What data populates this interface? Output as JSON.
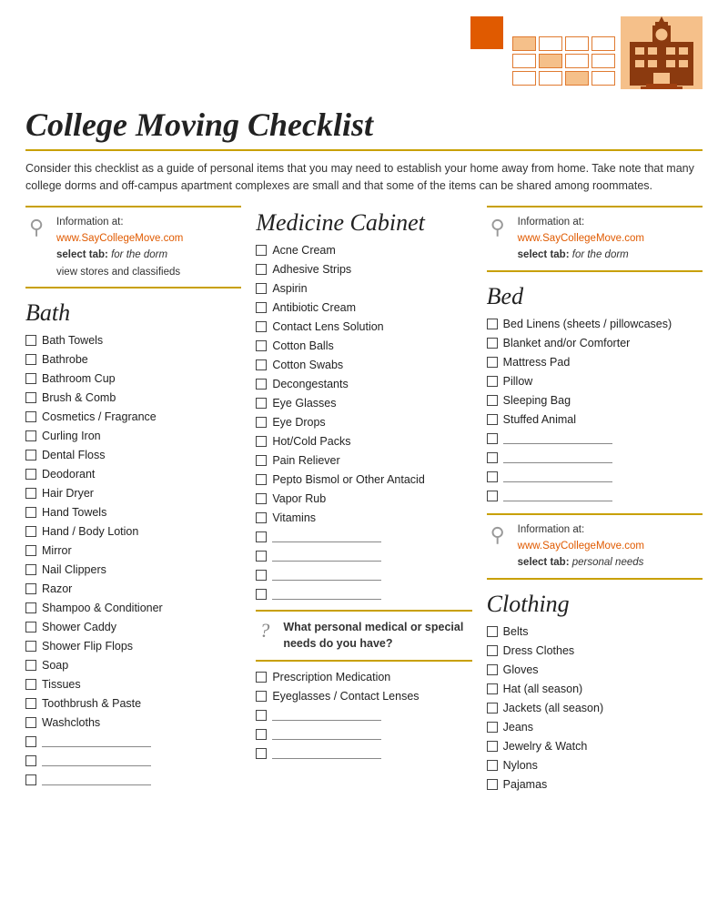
{
  "title": "College Moving Checklist",
  "intro": "Consider this checklist as a guide of personal items that you may need to establish your home away from home.  Take note that many college dorms and off-campus apartment complexes are small and that some of the items can be shared among roommates.",
  "info_box_1": {
    "label": "Information at:",
    "url": "www.SayCollegeMove.com",
    "select_label": "select tab:",
    "select_italic": "for the dorm",
    "extra": "view stores and classifieds"
  },
  "info_box_2": {
    "label": "Information at:",
    "url": "www.SayCollegeMove.com",
    "select_label": "select tab:",
    "select_italic": "for the dorm"
  },
  "info_box_3": {
    "label": "Information at:",
    "url": "www.SayCollegeMove.com",
    "select_label": "select tab:",
    "select_italic": "personal needs"
  },
  "bath": {
    "title": "Bath",
    "items": [
      "Bath Towels",
      "Bathrobe",
      "Bathroom Cup",
      "Brush & Comb",
      "Cosmetics / Fragrance",
      "Curling Iron",
      "Dental Floss",
      "Deodorant",
      "Hair Dryer",
      "Hand Towels",
      "Hand / Body Lotion",
      "Mirror",
      "Nail Clippers",
      "Razor",
      "Shampoo & Conditioner",
      "Shower Caddy",
      "Shower Flip Flops",
      "Soap",
      "Tissues",
      "Toothbrush & Paste",
      "Washcloths"
    ],
    "blanks": 3
  },
  "medicine": {
    "title": "Medicine Cabinet",
    "items": [
      "Acne Cream",
      "Adhesive Strips",
      "Aspirin",
      "Antibiotic Cream",
      "Contact Lens Solution",
      "Cotton Balls",
      "Cotton Swabs",
      "Decongestants",
      "Eye Glasses",
      "Eye Drops",
      "Hot/Cold Packs",
      "Pain Reliever",
      "Pepto Bismol or Other Antacid",
      "Vapor Rub",
      "Vitamins"
    ],
    "blanks": 4,
    "question": "What personal medical or special needs do you have?",
    "extra_items": [
      "Prescription Medication",
      "Eyeglasses / Contact Lenses"
    ],
    "extra_blanks": 3
  },
  "bed": {
    "title": "Bed",
    "items": [
      "Bed Linens (sheets / pillowcases)",
      "Blanket and/or Comforter",
      "Mattress Pad",
      "Pillow",
      "Sleeping Bag",
      "Stuffed Animal"
    ],
    "blanks": 4
  },
  "clothing": {
    "title": "Clothing",
    "items": [
      "Belts",
      "Dress Clothes",
      "Gloves",
      "Hat (all season)",
      "Jackets (all season)",
      "Jeans",
      "Jewelry & Watch",
      "Nylons",
      "Pajamas"
    ]
  }
}
